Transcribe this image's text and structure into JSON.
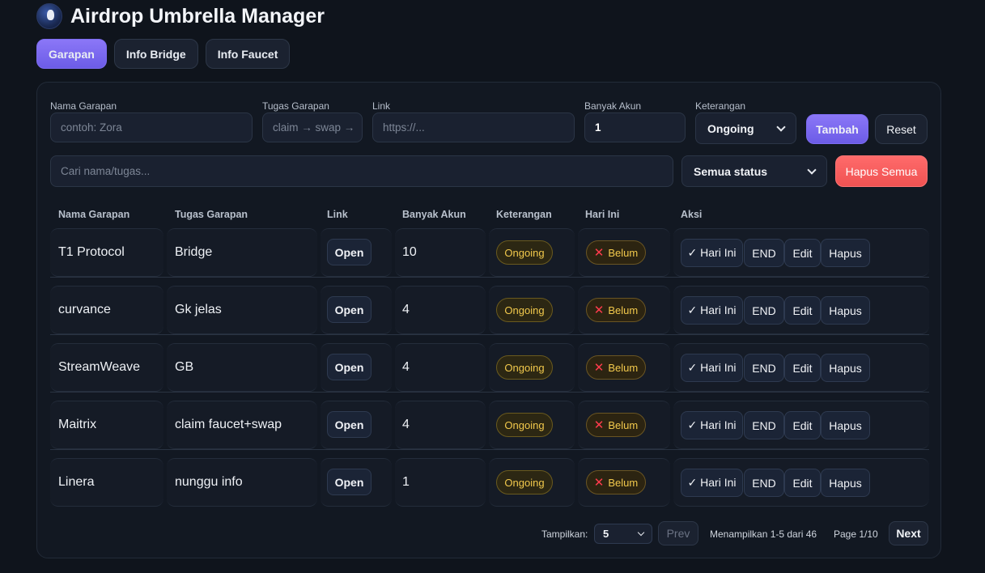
{
  "app": {
    "title": "Airdrop Umbrella Manager",
    "logo_icon": "astronaut-logo"
  },
  "tabs": [
    {
      "label": "Garapan",
      "active": true
    },
    {
      "label": "Info Bridge",
      "active": false
    },
    {
      "label": "Info Faucet",
      "active": false
    }
  ],
  "form": {
    "nama": {
      "label": "Nama Garapan",
      "placeholder": "contoh: Zora"
    },
    "tugas": {
      "label": "Tugas Garapan",
      "placeholder": "claim → swap →"
    },
    "link": {
      "label": "Link",
      "placeholder": "https://..."
    },
    "akun": {
      "label": "Banyak Akun",
      "value": "1"
    },
    "ket": {
      "label": "Keterangan",
      "value": "Ongoing"
    },
    "add_label": "Tambah",
    "reset_label": "Reset"
  },
  "filter": {
    "search_placeholder": "Cari nama/tugas...",
    "status_value": "Semua status",
    "delete_all_label": "Hapus Semua"
  },
  "table": {
    "headers": [
      "Nama Garapan",
      "Tugas Garapan",
      "Link",
      "Banyak Akun",
      "Keterangan",
      "Hari Ini",
      "Aksi"
    ],
    "open_label": "Open",
    "status_label": "Ongoing",
    "today_label": "Belum",
    "today_icon": "cross-mark-icon",
    "actions": {
      "today": "✓ Hari Ini",
      "end": "END",
      "edit": "Edit",
      "delete": "Hapus"
    },
    "rows": [
      {
        "nama": "T1 Protocol",
        "tugas": "Bridge",
        "akun": "10"
      },
      {
        "nama": "curvance",
        "tugas": "Gk jelas",
        "akun": "4"
      },
      {
        "nama": "StreamWeave",
        "tugas": "GB",
        "akun": "4"
      },
      {
        "nama": "Maitrix",
        "tugas": "claim faucet+swap",
        "akun": "4"
      },
      {
        "nama": "Linera",
        "tugas": "nunggu info",
        "akun": "1"
      }
    ]
  },
  "pager": {
    "show_label": "Tampilkan:",
    "page_size": "5",
    "prev_label": "Prev",
    "summary": "Menampilkan 1-5 dari 46",
    "page_info": "Page 1/10",
    "next_label": "Next"
  },
  "colors": {
    "background": "#0f141c",
    "accent": "#7c6cf0",
    "danger": "#f05252",
    "status_yellow": "#f2c94c",
    "cross_red": "#ff3b4d"
  }
}
